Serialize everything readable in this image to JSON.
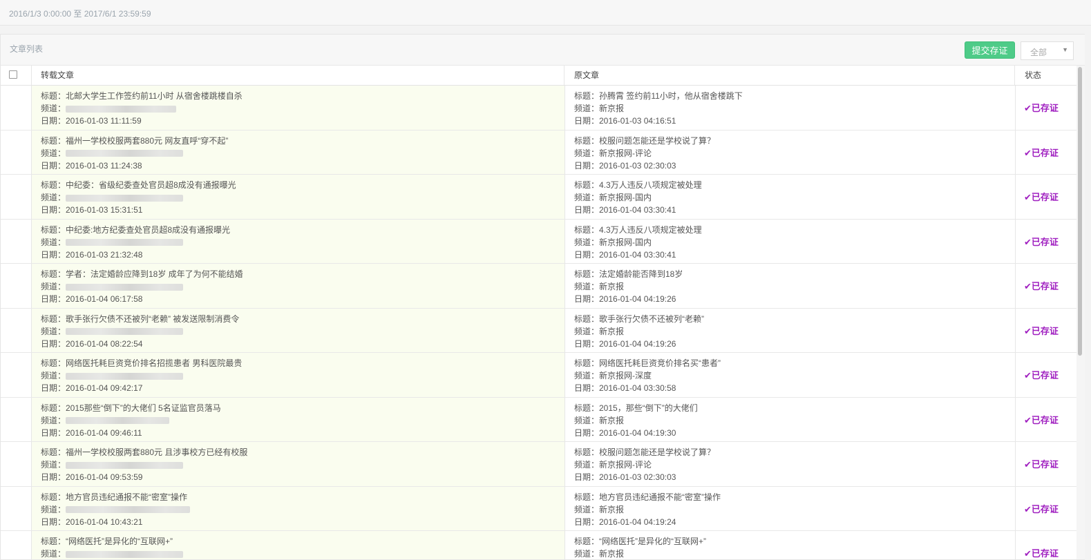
{
  "date_range": "2016/1/3 0:00:00 至 2017/6/1 23:59:59",
  "panel": {
    "title": "文章列表",
    "submit_label": "提交存证",
    "filter": {
      "selected": "全部"
    }
  },
  "table": {
    "headers": {
      "repost": "转载文章",
      "original": "原文章",
      "status": "状态"
    },
    "rows": [
      {
        "repost": {
          "title": "标题：北邮大学生工作签约前11小时 从宿舍楼跳楼自杀",
          "channel": "频道：",
          "date": "日期：2016-01-03 11:11:59"
        },
        "original": {
          "title": "标题：孙腾霄 签约前11小时，他从宿舍楼跳下",
          "channel": "频道：新京报",
          "date": "日期：2016-01-03 04:16:51"
        },
        "status": "✔已存证"
      },
      {
        "repost": {
          "title": "标题：福州一学校校服两套880元 网友直呼“穿不起”",
          "channel": "频道：",
          "date": "日期：2016-01-03 11:24:38"
        },
        "original": {
          "title": "标题：校服问题怎能还是学校说了算？",
          "channel": "频道：新京报网-评论",
          "date": "日期：2016-01-03 02:30:03"
        },
        "status": "✔已存证"
      },
      {
        "repost": {
          "title": "标题：中纪委：省级纪委查处官员超8成没有通报曝光",
          "channel": "频道：",
          "date": "日期：2016-01-03 15:31:51"
        },
        "original": {
          "title": "标题：4.3万人违反八项规定被处理",
          "channel": "频道：新京报网-国内",
          "date": "日期：2016-01-04 03:30:41"
        },
        "status": "✔已存证"
      },
      {
        "repost": {
          "title": "标题：中纪委:地方纪委查处官员超8成没有通报曝光",
          "channel": "频道：",
          "date": "日期：2016-01-03 21:32:48"
        },
        "original": {
          "title": "标题：4.3万人违反八项规定被处理",
          "channel": "频道：新京报网-国内",
          "date": "日期：2016-01-04 03:30:41"
        },
        "status": "✔已存证"
      },
      {
        "repost": {
          "title": "标题：学者：法定婚龄应降到18岁 成年了为何不能结婚",
          "channel": "频道：",
          "date": "日期：2016-01-04 06:17:58"
        },
        "original": {
          "title": "标题：法定婚龄能否降到18岁",
          "channel": "频道：新京报",
          "date": "日期：2016-01-04 04:19:26"
        },
        "status": "✔已存证"
      },
      {
        "repost": {
          "title": "标题：歌手张行欠债不还被列“老赖” 被发送限制消费令",
          "channel": "频道：",
          "date": "日期：2016-01-04 08:22:54"
        },
        "original": {
          "title": "标题：歌手张行欠债不还被列“老赖”",
          "channel": "频道：新京报",
          "date": "日期：2016-01-04 04:19:26"
        },
        "status": "✔已存证"
      },
      {
        "repost": {
          "title": "标题：网络医托耗巨资竞价排名招揽患者 男科医院最贵",
          "channel": "频道：",
          "date": "日期：2016-01-04 09:42:17"
        },
        "original": {
          "title": "标题：网络医托耗巨资竞价排名买“患者”",
          "channel": "频道：新京报网-深度",
          "date": "日期：2016-01-04 03:30:58"
        },
        "status": "✔已存证"
      },
      {
        "repost": {
          "title": "标题：2015那些“倒下”的大佬们 5名证监官员落马",
          "channel": "频道：",
          "date": "日期：2016-01-04 09:46:11"
        },
        "original": {
          "title": "标题：2015，那些“倒下”的大佬们",
          "channel": "频道：新京报",
          "date": "日期：2016-01-04 04:19:30"
        },
        "status": "✔已存证"
      },
      {
        "repost": {
          "title": "标题：福州一学校校服两套880元 且涉事校方已经有校服",
          "channel": "频道：",
          "date": "日期：2016-01-04 09:53:59"
        },
        "original": {
          "title": "标题：校服问题怎能还是学校说了算？",
          "channel": "频道：新京报网-评论",
          "date": "日期：2016-01-03 02:30:03"
        },
        "status": "✔已存证"
      },
      {
        "repost": {
          "title": "标题：地方官员违纪通报不能“密室”操作",
          "channel": "频道：",
          "date": "日期：2016-01-04 10:43:21"
        },
        "original": {
          "title": "标题：地方官员违纪通报不能“密室”操作",
          "channel": "频道：新京报",
          "date": "日期：2016-01-04 04:19:24"
        },
        "status": "✔已存证"
      },
      {
        "repost": {
          "title": "标题：“网络医托”是异化的“互联网+”",
          "channel": "频道：",
          "date": ""
        },
        "original": {
          "title": "标题：“网络医托”是异化的“互联网+”",
          "channel": "频道：新京报",
          "date": ""
        },
        "status": "✔已存证"
      }
    ]
  }
}
